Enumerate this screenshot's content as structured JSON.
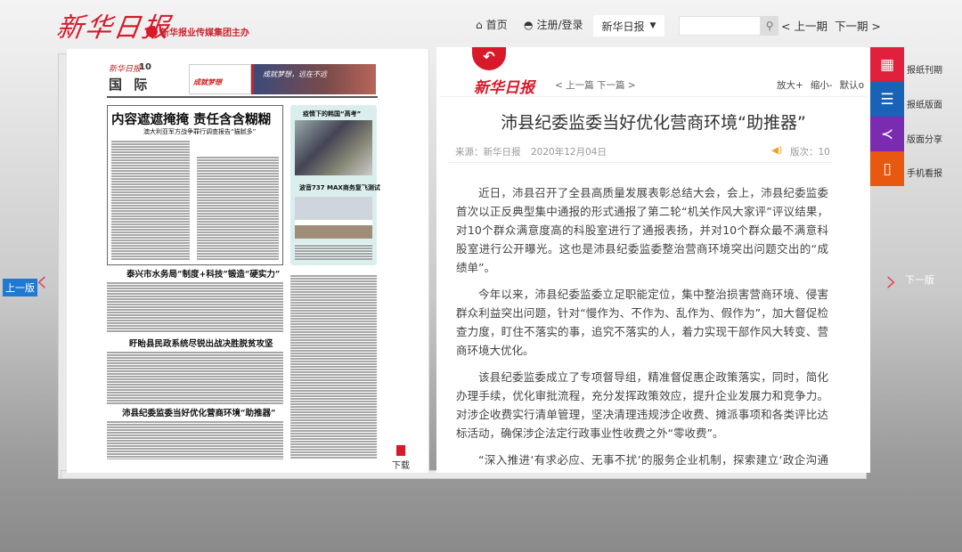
{
  "header": {
    "logo": "新华日报",
    "sublogo": "新华报业传媒集团主办",
    "home": "首页",
    "login": "注册/登录",
    "paper_select": "新华日报",
    "search_placeholder": "",
    "prev_issue": "< 上一期",
    "next_issue": "下一期 >"
  },
  "newspaper": {
    "brand": "新华日报",
    "page_no": "10",
    "section": "国 际",
    "ad_left": "成就梦想",
    "ad_right": "成就梦想，远在不远",
    "headline_main": "内容遮遮掩掩 责任含含糊糊",
    "subhead_main": "澳大利亚军方战争罪行调查报告“猫腻多”",
    "side_title1": "疫情下的韩国“高考”",
    "side_title2": "波音737 MAX商务复飞测试",
    "headline2": "泰兴市水务局“制度+科技”锻造“硬实力”",
    "headline3": "盱眙县民政系统尽锐出战决胜脱贫攻坚",
    "headline4": "沛县纪委监委当好优化营商环境“助推器”",
    "download": "下载"
  },
  "page_nav": {
    "prev": "上一版",
    "next": "下一版"
  },
  "article": {
    "logo": "新华日报",
    "prev_next": "< 上一篇 下一篇 >",
    "zoom_in": "放大+",
    "zoom_out": "缩小-",
    "zoom_default": "默认o",
    "title": "沛县纪委监委当好优化营商环境“助推器”",
    "source": "来源：新华日报",
    "date": "2020年12月04日",
    "edition": "版次：10",
    "paragraphs": [
      "近日，沛县召开了全县高质量发展表彰总结大会，会上，沛县纪委监委首次以正反典型集中通报的形式通报了第二轮“机关作风大家评”评议结果，对10个群众满意度高的科股室进行了通报表扬，并对10个群众最不满意科股室进行公开曝光。这也是沛县纪委监委整治营商环境突出问题交出的“成绩单”。",
      "今年以来，沛县纪委监委立足职能定位，集中整治损害营商环境、侵害群众利益突出问题，针对“慢作为、不作为、乱作为、假作为”，加大督促检查力度，盯住不落实的事，追究不落实的人，着力实现干部作风大转变、营商环境大优化。",
      "该县纪委监委成立了专项督导组，精准督促惠企政策落实，同时，简化办理手续，优化审批流程，充分发挥政策效应，提升企业发展力和竞争力。对涉企收费实行清单管理，坚决清理违规涉企收费、摊派事项和各类评比达标活动，确保涉企法定行政事业性收费之外“零收费”。",
      "“深入推进‘有求必应、无事不扰’的服务企业机制，探索建立‘政企沟通日’、服务企业专班、重点企业联络专员等制度，构建无缝对接、同频共振的政企‘直通车’。”沛县纪委监委党风政风监督室主任贾峰立介绍说，该县由重点涉企部门主要负责人牵头，建立联系企业制度，定期走访企业，收集问题诉求，推动解决。"
    ]
  },
  "sidebar": [
    {
      "label": "报纸刊期",
      "icon": "calendar-icon",
      "color": "#e0203c"
    },
    {
      "label": "报纸版面",
      "icon": "list-icon",
      "color": "#1a62b8"
    },
    {
      "label": "版面分享",
      "icon": "share-icon",
      "color": "#7a2bb0"
    },
    {
      "label": "手机看报",
      "icon": "mobile-icon",
      "color": "#e8580e"
    }
  ]
}
